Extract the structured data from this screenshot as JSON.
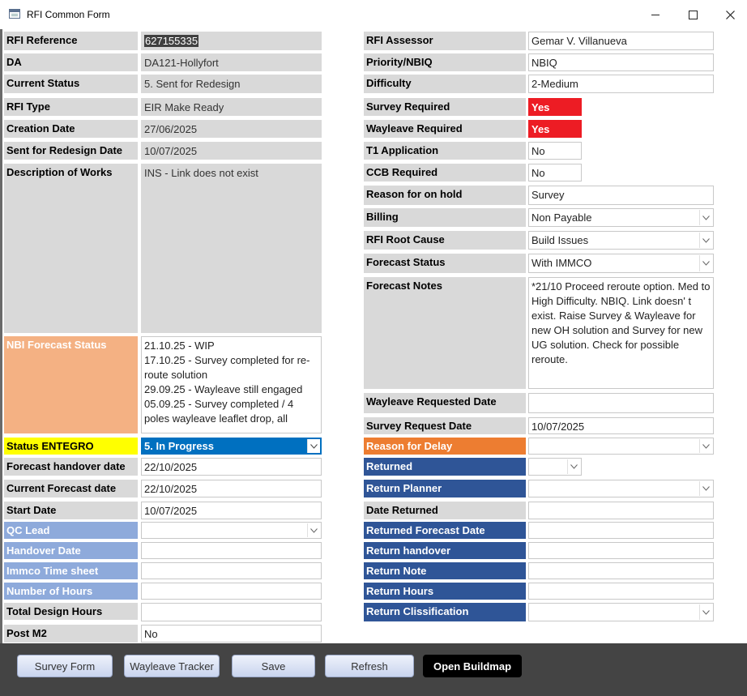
{
  "window": {
    "title": "RFI Common Form"
  },
  "left": {
    "rfi_reference": {
      "label": "RFI Reference",
      "value": "627155335"
    },
    "da": {
      "label": "DA",
      "value": "DA121-Hollyfort"
    },
    "current_status": {
      "label": "Current Status",
      "value": "5. Sent for Redesign"
    },
    "rfi_type": {
      "label": "RFI Type",
      "value": "EIR Make Ready"
    },
    "creation_date": {
      "label": "Creation Date",
      "value": "27/06/2025"
    },
    "sent_for_redesign_date": {
      "label": "Sent for Redesign Date",
      "value": "10/07/2025"
    },
    "description_of_works": {
      "label": "Description of Works",
      "value": "INS - Link does not exist"
    },
    "nbi_forecast_status": {
      "label": "NBI Forecast Status",
      "value": "21.10.25 - WIP\n17.10.25 - Survey completed for re-route solution\n29.09.25 - Wayleave still engaged\n05.09.25 - Survey completed / 4 poles wayleave leaflet drop, all"
    },
    "status_entegro": {
      "label": "Status ENTEGRO",
      "value": "5. In Progress"
    },
    "forecast_handover_date": {
      "label": "Forecast handover date",
      "value": "22/10/2025"
    },
    "current_forecast_date": {
      "label": "Current Forecast date",
      "value": "22/10/2025"
    },
    "start_date": {
      "label": "Start Date",
      "value": "10/07/2025"
    },
    "qc_lead": {
      "label": "QC Lead",
      "value": ""
    },
    "handover_date": {
      "label": "Handover Date",
      "value": ""
    },
    "immco_time_sheet": {
      "label": "Immco Time sheet",
      "value": ""
    },
    "number_of_hours": {
      "label": "Number of Hours",
      "value": ""
    },
    "total_design_hours": {
      "label": "Total Design Hours",
      "value": ""
    },
    "post_m2": {
      "label": "Post M2",
      "value": "No"
    }
  },
  "right": {
    "rfi_assessor": {
      "label": "RFI Assessor",
      "value": "Gemar V. Villanueva"
    },
    "priority_nbiq": {
      "label": "Priority/NBIQ",
      "value": "NBIQ"
    },
    "difficulty": {
      "label": "Difficulty",
      "value": "2-Medium"
    },
    "survey_required": {
      "label": "Survey Required",
      "value": "Yes"
    },
    "wayleave_required": {
      "label": "Wayleave Required",
      "value": "Yes"
    },
    "t1_application": {
      "label": "T1 Application",
      "value": "No"
    },
    "ccb_required": {
      "label": "CCB Required",
      "value": "No"
    },
    "reason_on_hold": {
      "label": "Reason for on hold",
      "value": "Survey"
    },
    "billing": {
      "label": "Billing",
      "value": "Non Payable"
    },
    "rfi_root_cause": {
      "label": "RFI Root Cause",
      "value": "Build Issues"
    },
    "forecast_status": {
      "label": "Forecast Status",
      "value": "With IMMCO"
    },
    "forecast_notes": {
      "label": "Forecast Notes",
      "value": "*21/10 Proceed reroute option. Med to High Difficulty. NBIQ. Link doesn' t exist. Raise Survey & Wayleave for new OH solution and Survey for new UG solution. Check for possible reroute."
    },
    "wayleave_requested_date": {
      "label": "Wayleave Requested Date",
      "value": ""
    },
    "survey_request_date": {
      "label": "Survey Request Date",
      "value": "10/07/2025"
    },
    "reason_for_delay": {
      "label": "Reason for Delay",
      "value": ""
    },
    "returned": {
      "label": "Returned",
      "value": ""
    },
    "return_planner": {
      "label": "Return Planner",
      "value": ""
    },
    "date_returned": {
      "label": "Date Returned",
      "value": ""
    },
    "returned_forecast_date": {
      "label": "Returned Forecast Date",
      "value": ""
    },
    "return_handover": {
      "label": "Return handover",
      "value": ""
    },
    "return_note": {
      "label": "Return Note",
      "value": ""
    },
    "return_hours": {
      "label": "Return Hours",
      "value": ""
    },
    "return_classification": {
      "label": "Return Clissification",
      "value": ""
    }
  },
  "buttons": {
    "survey_form": "Survey Form",
    "wayleave_tracker": "Wayleave Tracker",
    "save": "Save",
    "refresh": "Refresh",
    "open_buildmap": "Open Buildmap"
  },
  "colors": {
    "label_grey": "#d9d9d9",
    "required_red": "#ed1c24",
    "status_blue": "#0070c0",
    "navy_label": "#2f5597",
    "light_blue_label": "#8eaadb",
    "orange_label": "#f4b183",
    "dark_orange_label": "#ed7d31",
    "yellow_label": "#ffff00"
  },
  "icons": {
    "app": "form-icon",
    "minimize": "minimize-icon",
    "maximize": "maximize-icon",
    "close": "close-icon",
    "dropdown": "chevron-down-icon"
  }
}
